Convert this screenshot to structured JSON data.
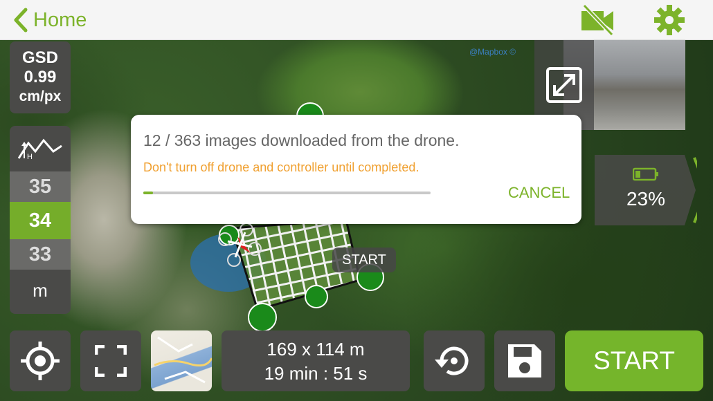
{
  "header": {
    "back_label": "Home",
    "accent": "#7cb32a",
    "icons": [
      "chevron-left-icon",
      "video-off-icon",
      "gear-icon"
    ]
  },
  "map": {
    "credit": "@Mapbox ©"
  },
  "gsd": {
    "label": "GSD",
    "value": "0.99",
    "unit": "cm/px"
  },
  "altitude": {
    "icon": "terrain-height-icon",
    "options": [
      "35",
      "34",
      "33"
    ],
    "selected": "34",
    "unit": "m"
  },
  "battery": {
    "icon": "battery-icon",
    "level": "23%"
  },
  "download_dialog": {
    "message": "12 / 363 images downloaded from the drone.",
    "warning": "Don't turn off drone and controller until completed.",
    "progress": 0.033,
    "cancel_label": "CANCEL",
    "warning_color": "#f0a030"
  },
  "plan": {
    "start_tag": "START"
  },
  "footer": {
    "dimensions": "169 x 114 m",
    "duration": "19 min : 51 s",
    "start_label": "START",
    "start_color": "#75b52b"
  }
}
